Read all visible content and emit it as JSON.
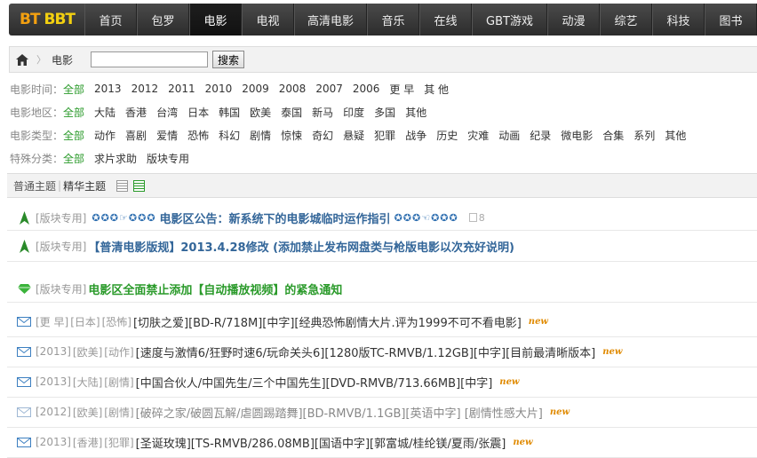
{
  "nav": {
    "logo": "BT BBT",
    "items": [
      "首页",
      "包罗",
      "电影",
      "电视",
      "高清电影",
      "音乐",
      "在线",
      "GBT游戏",
      "动漫",
      "综艺",
      "科技",
      "图书"
    ],
    "active_index": 2
  },
  "breadcrumb": {
    "current": "电影",
    "search_value": "",
    "search_button": "搜索"
  },
  "filters": [
    {
      "label": "电影时间：",
      "options": [
        "全部",
        "2013",
        "2012",
        "2011",
        "2010",
        "2009",
        "2008",
        "2007",
        "2006",
        "更 早",
        "其 他"
      ]
    },
    {
      "label": "电影地区：",
      "options": [
        "全部",
        "大陆",
        "香港",
        "台湾",
        "日本",
        "韩国",
        "欧美",
        "泰国",
        "新马",
        "印度",
        "多国",
        "其他"
      ]
    },
    {
      "label": "电影类型：",
      "options": [
        "全部",
        "动作",
        "喜剧",
        "爱情",
        "恐怖",
        "科幻",
        "剧情",
        "惊悚",
        "奇幻",
        "悬疑",
        "犯罪",
        "战争",
        "历史",
        "灾难",
        "动画",
        "纪录",
        "微电影",
        "合集",
        "系列",
        "其他"
      ]
    },
    {
      "label": "特殊分类：",
      "options": [
        "全部",
        "求片求助",
        "版块专用"
      ]
    }
  ],
  "thread_list": {
    "normal_label": "普通主题",
    "divider": "|",
    "elite_label": "精华主题"
  },
  "threads": [
    {
      "icon": "green-arrow",
      "tags": [
        "[版块专用]"
      ],
      "deco_before": "✪✪✪☞✪✪✪",
      "title": "电影区公告：新系统下的电影城临时运作指引",
      "deco_after": "✪✪✪☜✪✪✪",
      "style": "blue",
      "replies": "8",
      "new": ""
    },
    {
      "icon": "green-arrow",
      "tags": [
        "[版块专用]"
      ],
      "title": "【普清电影版规】2013.4.28修改 (添加禁止发布网盘类与枪版电影以次充好说明)",
      "style": "blue",
      "new": ""
    },
    {
      "icon": "green-gem",
      "tags": [
        "[版块专用]"
      ],
      "title": "电影区全面禁止添加【自动播放视频】的紧急通知",
      "style": "green",
      "new": ""
    },
    {
      "icon": "envelope",
      "tags": [
        "[更 早]",
        "[日本]",
        "[恐怖]"
      ],
      "title": "[切肤之爱][BD-R/718M][中字][经典恐怖剧情大片.评为1999不可不看电影]",
      "style": "normal",
      "new": "new"
    },
    {
      "icon": "envelope",
      "tags": [
        "[2013]",
        "[欧美]",
        "[动作]"
      ],
      "title": "[速度与激情6/狂野时速6/玩命关头6][1280版TC-RMVB/1.12GB][中字][目前最清晰版本]",
      "style": "normal",
      "new": "new"
    },
    {
      "icon": "envelope",
      "tags": [
        "[2013]",
        "[大陆]",
        "[剧情]"
      ],
      "title": "[中国合伙人/中国先生/三个中国先生][DVD-RMVB/713.66MB][中字]",
      "style": "normal",
      "new": "new"
    },
    {
      "icon": "envelope-faded",
      "tags": [
        "[2012]",
        "[欧美]",
        "[剧情]"
      ],
      "title": "[破碎之家/破圆瓦解/虐圆踢踏舞][BD-RMVB/1.1GB][英语中字] [剧情性感大片]",
      "style": "gray",
      "new": "new"
    },
    {
      "icon": "envelope",
      "tags": [
        "[2013]",
        "[香港]",
        "[犯罪]"
      ],
      "title": "[圣诞玫瑰][TS-RMVB/286.08MB][国语中字][郭富城/桂纶镁/夏雨/张震]",
      "style": "normal",
      "new": "new"
    }
  ],
  "colors": {
    "accent_green": "#2a9a2a",
    "title_blue": "#336699",
    "new_orange": "#e08a00",
    "nav_dark": "#333333"
  }
}
